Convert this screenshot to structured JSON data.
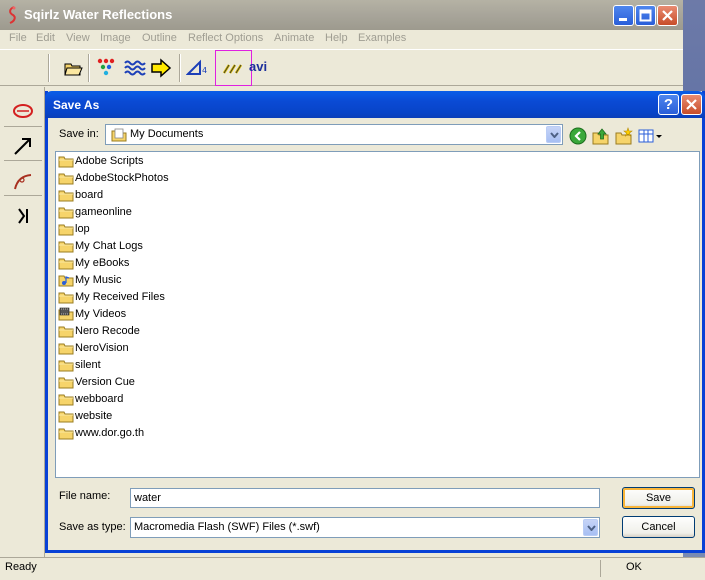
{
  "app": {
    "title": "Sqirlz Water Reflections",
    "menu": [
      "File",
      "Edit",
      "View",
      "Image",
      "Outline",
      "Reflect Options",
      "Animate",
      "Help",
      "Examples"
    ],
    "toolbar": {
      "avi_label": "avi"
    },
    "status": {
      "left": "Ready",
      "right": "OK"
    }
  },
  "dialog": {
    "title": "Save As",
    "help_glyph": "?",
    "save_in_label": "Save in:",
    "save_in_value": "My Documents",
    "items": [
      {
        "name": "Adobe Scripts",
        "icon": "folder-icon"
      },
      {
        "name": "AdobeStockPhotos",
        "icon": "folder-icon"
      },
      {
        "name": "board",
        "icon": "folder-icon"
      },
      {
        "name": "gameonline",
        "icon": "folder-icon"
      },
      {
        "name": "lop",
        "icon": "folder-icon"
      },
      {
        "name": "My Chat Logs",
        "icon": "folder-icon"
      },
      {
        "name": "My eBooks",
        "icon": "folder-icon"
      },
      {
        "name": "My Music",
        "icon": "music-folder-icon"
      },
      {
        "name": "My Received Files",
        "icon": "folder-icon"
      },
      {
        "name": "My Videos",
        "icon": "video-folder-icon"
      },
      {
        "name": "Nero Recode",
        "icon": "folder-icon"
      },
      {
        "name": "NeroVision",
        "icon": "folder-icon"
      },
      {
        "name": "silent",
        "icon": "folder-icon"
      },
      {
        "name": "Version Cue",
        "icon": "folder-icon"
      },
      {
        "name": "webboard",
        "icon": "folder-icon"
      },
      {
        "name": "website",
        "icon": "folder-icon"
      },
      {
        "name": "www.dor.go.th",
        "icon": "folder-icon"
      }
    ],
    "file_name_label": "File name:",
    "file_name_value": "water",
    "save_type_label": "Save as type:",
    "save_type_value": "Macromedia Flash (SWF) Files (*.swf)",
    "save_button": "Save",
    "cancel_button": "Cancel"
  },
  "colors": {
    "dialog_title_bg": "#0a4ad4",
    "folder_yellow": "#f6d46a",
    "highlight_box": "#e020e0",
    "inactive_title": "#a8a59a"
  }
}
